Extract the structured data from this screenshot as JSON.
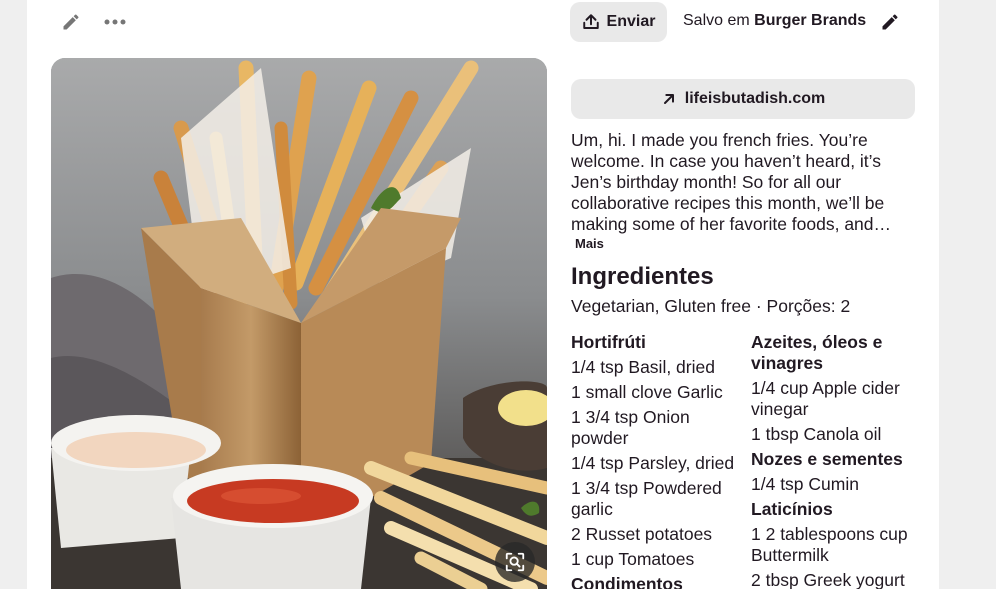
{
  "toolbar": {
    "edit_icon": "pencil-icon",
    "more_icon": "ellipsis-icon"
  },
  "header": {
    "share_label": "Enviar",
    "saved_prefix": "Salvo em",
    "board_name": "Burger Brands"
  },
  "source": {
    "domain": "lifeisbutadish.com"
  },
  "description": {
    "text": "Um, hi. I made you french fries. You’re welcome. In case you haven’t heard, it’s Jen’s birthday month! So for all our collaborative recipes this month, we’ll be making some of her favorite foods, and…",
    "more_label": "Mais"
  },
  "ingredients": {
    "title": "Ingredientes",
    "meta": "Vegetarian, Gluten free · Porções: 2",
    "left_column": [
      {
        "category": "Hortifrúti",
        "items": [
          "1/4 tsp Basil, dried",
          "1 small clove Garlic",
          "1 3/4 tsp Onion powder",
          "1/4 tsp Parsley, dried",
          "1 3/4 tsp Powdered garlic",
          "2 Russet potatoes",
          "1 cup Tomatoes"
        ]
      },
      {
        "category": "Condimentos",
        "items": []
      }
    ],
    "right_column": [
      {
        "category": "Azeites, óleos e vinagres",
        "items": [
          "1/4 cup Apple cider vinegar",
          "1 tbsp Canola oil"
        ]
      },
      {
        "category": "Nozes e sementes",
        "items": [
          "1/4 tsp Cumin"
        ]
      },
      {
        "category": "Laticínios",
        "items": [
          "1 2 tablespoons cup Buttermilk",
          "2 tbsp Greek yogurt"
        ]
      }
    ]
  },
  "colors": {
    "page_bg": "#efefef",
    "card_bg": "#ffffff",
    "button_bg": "#e9e9e9",
    "text": "#211922"
  }
}
